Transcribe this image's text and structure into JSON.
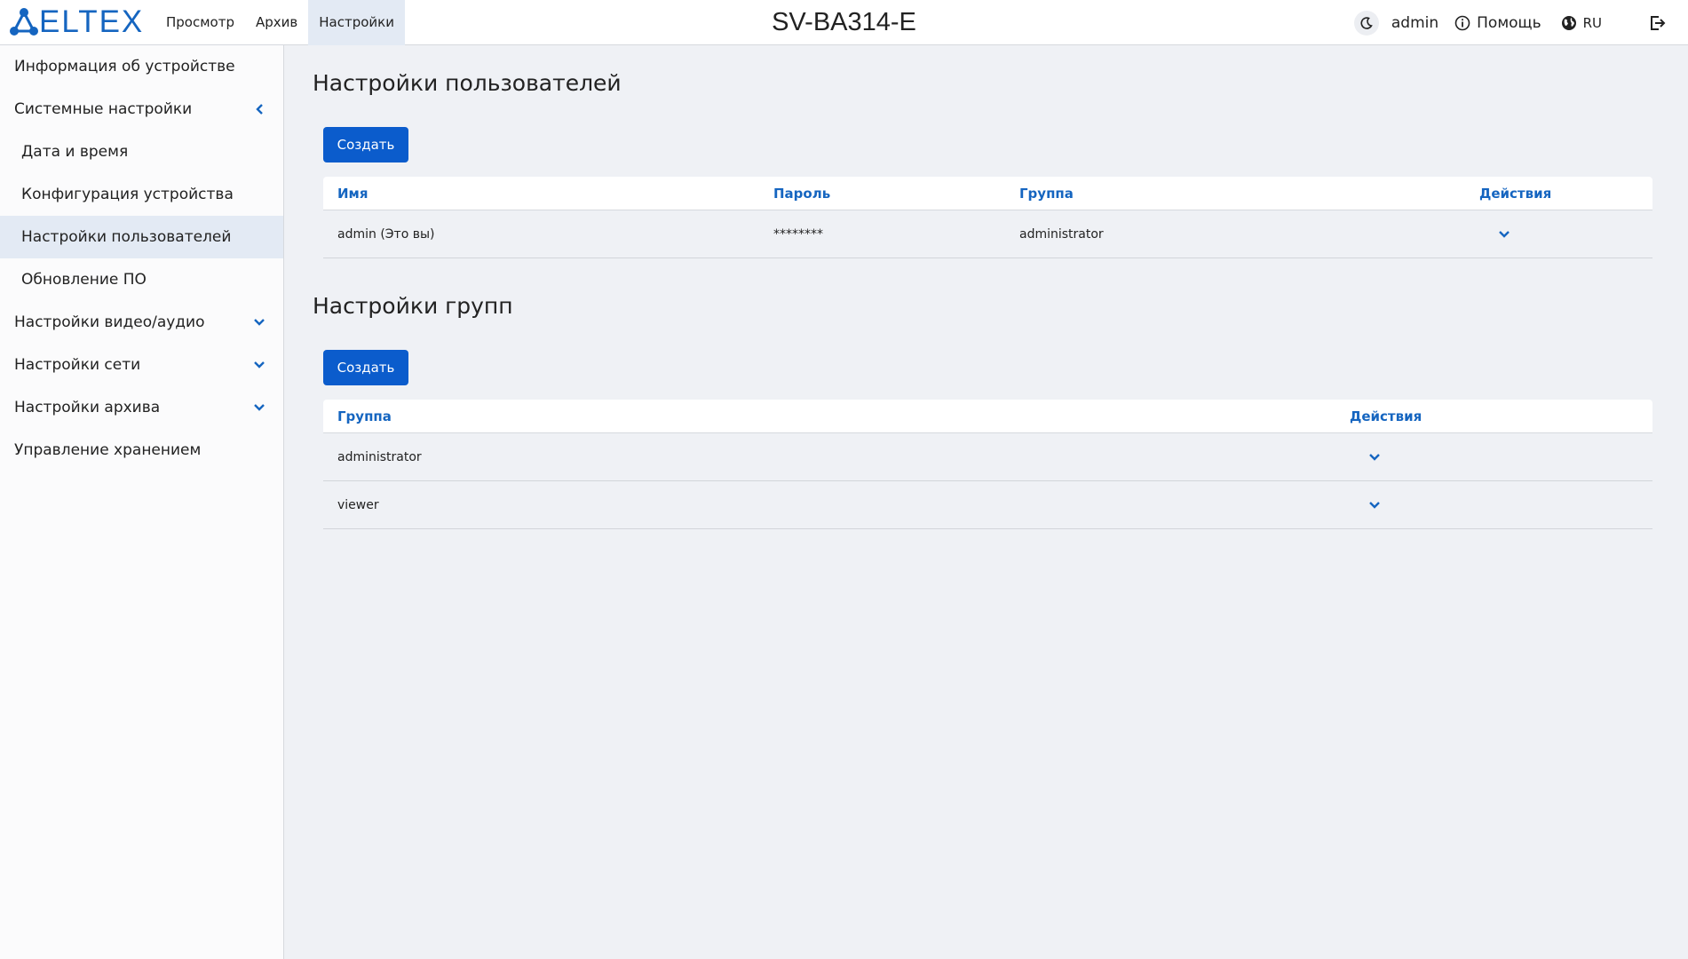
{
  "header": {
    "logo_text": "ELTEX",
    "nav": [
      "Просмотр",
      "Архив",
      "Настройки"
    ],
    "title": "SV-BA314-E",
    "user": "admin",
    "help": "Помощь",
    "lang": "RU"
  },
  "sidebar": {
    "items": [
      "Информация об устройстве",
      "Системные настройки",
      "Дата и время",
      "Конфигурация устройства",
      "Настройки пользователей",
      "Обновление ПО",
      "Настройки видео/аудио",
      "Настройки сети",
      "Настройки архива",
      "Управление хранением"
    ]
  },
  "users": {
    "title": "Настройки пользователей",
    "create_label": "Создать",
    "columns": [
      "Имя",
      "Пароль",
      "Группа",
      "Действия"
    ],
    "rows": [
      {
        "name": "admin (Это вы)",
        "password": "********",
        "group": "administrator"
      }
    ]
  },
  "groups": {
    "title": "Настройки групп",
    "create_label": "Создать",
    "columns": [
      "Группа",
      "Действия"
    ],
    "rows": [
      {
        "group": "administrator"
      },
      {
        "group": "viewer"
      }
    ]
  },
  "colors": {
    "accent": "#1565c0",
    "button": "#0b5ccc",
    "active_bg": "#e3eaf4",
    "bg": "#eff1f5"
  }
}
